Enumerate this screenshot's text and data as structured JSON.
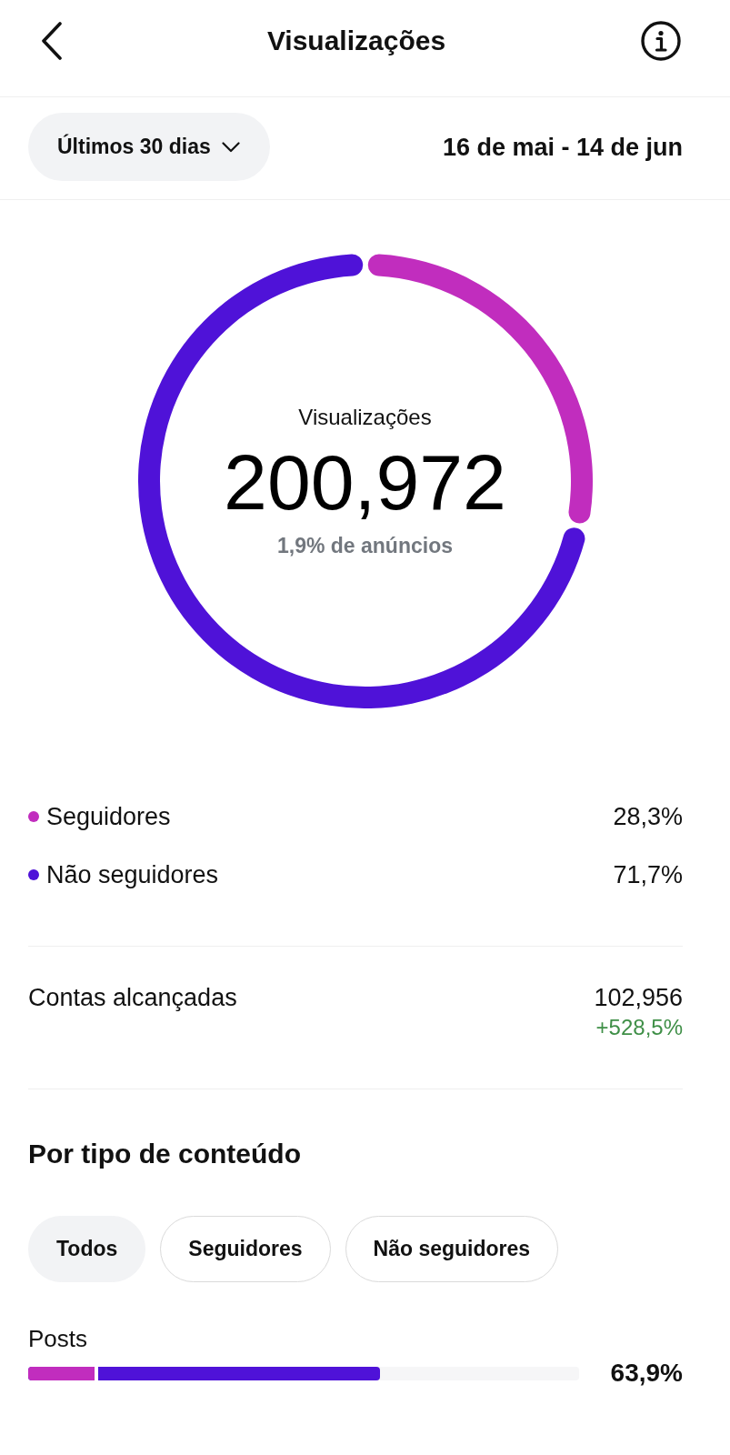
{
  "header": {
    "title": "Visualizações"
  },
  "range": {
    "period": "Últimos 30 dias",
    "dates": "16 de mai - 14 de jun"
  },
  "views": {
    "label": "Visualizações",
    "total": "200,972",
    "ads_note": "1,9% de anúncios",
    "chart_data": {
      "type": "donut",
      "categories": [
        "Seguidores",
        "Não seguidores"
      ],
      "values": [
        28.3,
        71.7
      ]
    }
  },
  "legend": [
    {
      "value": "28,3%",
      "color": "#c12dbe"
    },
    {
      "value": "71,7%",
      "color": "#4f12d8"
    }
  ],
  "reach": {
    "label": "Contas alcançadas",
    "value": "102,956",
    "change": "+528,5%"
  },
  "content": {
    "title": "Por tipo de conteúdo",
    "filters": [
      {
        "label": "Todos",
        "selected": true
      },
      {
        "label": "Seguidores",
        "selected": false
      },
      {
        "label": "Não seguidores",
        "selected": false
      }
    ],
    "bars": [
      {
        "label": "Posts",
        "value": "63,9%",
        "segments": [
          {
            "level": 0.127
          },
          {
            "level": 0.639
          }
        ]
      }
    ]
  }
}
